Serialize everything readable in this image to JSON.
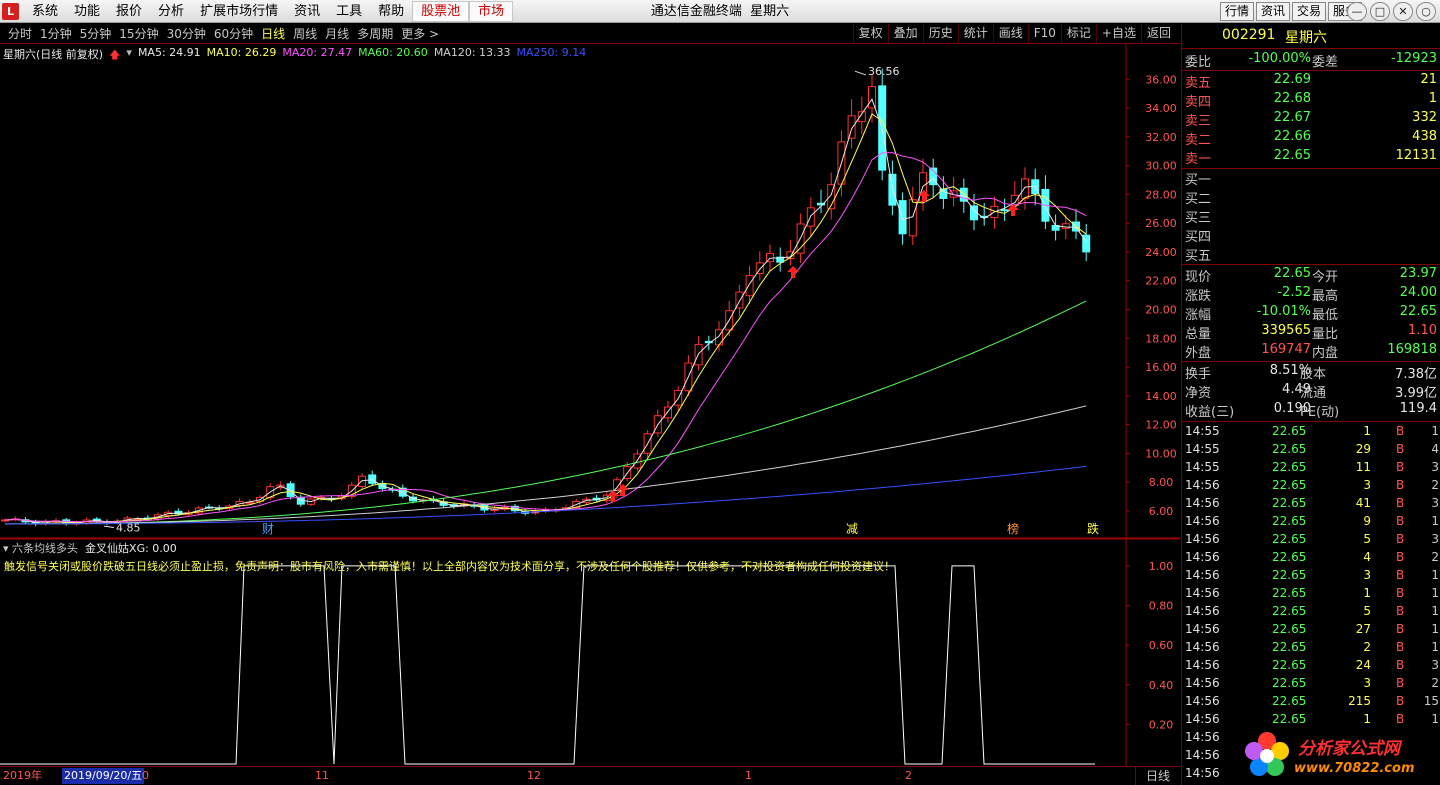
{
  "app": {
    "logo_text": "L",
    "title": "通达信金融终端",
    "stock_title": "星期六"
  },
  "menu": [
    "系统",
    "功能",
    "报价",
    "分析",
    "扩展市场行情",
    "资讯",
    "工具",
    "帮助"
  ],
  "menu_tabs": [
    "股票池",
    "市场"
  ],
  "top_right_buttons": [
    "行情",
    "资讯",
    "交易",
    "服务"
  ],
  "window_controls": [
    "—",
    "□",
    "✕",
    "○"
  ],
  "period_tabs": [
    {
      "label": "分时"
    },
    {
      "label": "1分钟"
    },
    {
      "label": "5分钟"
    },
    {
      "label": "15分钟"
    },
    {
      "label": "30分钟"
    },
    {
      "label": "60分钟"
    },
    {
      "label": "日线",
      "active": true
    },
    {
      "label": "周线"
    },
    {
      "label": "月线"
    },
    {
      "label": "多周期"
    },
    {
      "label": "更多 >"
    }
  ],
  "tool_tabs": [
    "复权",
    "叠加",
    "历史",
    "统计",
    "画线",
    "F10",
    "标记",
    "+自选",
    "返回"
  ],
  "ma_header": {
    "stock_label": "星期六(日线 前复权)",
    "items": [
      {
        "label": "MA5: 24.91",
        "color": "#e8e8e8"
      },
      {
        "label": "MA10: 26.29",
        "color": "#ffff54"
      },
      {
        "label": "MA20: 27.47",
        "color": "#ff54ff"
      },
      {
        "label": "MA60: 20.60",
        "color": "#54ff54"
      },
      {
        "label": "MA120: 13.33",
        "color": "#d0d0d0"
      },
      {
        "label": "MA250: 9.14",
        "color": "#3850ff"
      }
    ]
  },
  "chart_data": [
    {
      "type": "candlestick",
      "title": "",
      "price_axis_ticks": [
        "36.00",
        "34.00",
        "32.00",
        "30.00",
        "28.00",
        "26.00",
        "24.00",
        "22.00",
        "20.00",
        "18.00",
        "16.00",
        "14.00",
        "12.00",
        "10.00",
        "8.00",
        "6.00"
      ],
      "ylim": [
        4.4,
        37.2
      ],
      "max_label": "36.56",
      "min_label": "4.85",
      "event_markers": [
        "财",
        "减",
        "榜",
        "跌"
      ],
      "x_month_labels": [
        "0",
        "11",
        "12",
        "1",
        "2"
      ]
    },
    {
      "type": "line",
      "title": "六条均线多头",
      "subtitle": "金叉仙姑XG: 0.00",
      "y_axis_ticks": [
        "1.00",
        "0.80",
        "0.60",
        "0.40",
        "0.20"
      ],
      "ylim": [
        0,
        1.05
      ]
    }
  ],
  "disclaimer": "触发信号关闭或股价跌破五日线必须止盈止损，免责声明：股市有风险，入市需谨慎！以上全部内容仅为技术面分享，不涉及任何个股推荐！仅供参考，不对投资者构成任何投资建议！",
  "date_bar": {
    "year": "2019年",
    "current": "2019/09/20/五",
    "period": "日线"
  },
  "quote": {
    "code": "002291",
    "name": "星期六",
    "weibi_label": "委比",
    "weibi": "-100.00%",
    "weicha_label": "委差",
    "weicha": "-12923",
    "asks": [
      {
        "label": "卖五",
        "price": "22.69",
        "vol": "21"
      },
      {
        "label": "卖四",
        "price": "22.68",
        "vol": "1"
      },
      {
        "label": "卖三",
        "price": "22.67",
        "vol": "332"
      },
      {
        "label": "卖二",
        "price": "22.66",
        "vol": "438"
      },
      {
        "label": "卖一",
        "price": "22.65",
        "vol": "12131"
      }
    ],
    "bids": [
      {
        "label": "买一"
      },
      {
        "label": "买二"
      },
      {
        "label": "买三"
      },
      {
        "label": "买四"
      },
      {
        "label": "买五"
      }
    ],
    "stats": [
      {
        "l1": "现价",
        "v1": "22.65",
        "c1": "grn",
        "l2": "今开",
        "v2": "23.97",
        "c2": "grn"
      },
      {
        "l1": "涨跌",
        "v1": "-2.52",
        "c1": "grn",
        "l2": "最高",
        "v2": "24.00",
        "c2": "grn"
      },
      {
        "l1": "涨幅",
        "v1": "-10.01%",
        "c1": "grn",
        "l2": "最低",
        "v2": "22.65",
        "c2": "grn"
      },
      {
        "l1": "总量",
        "v1": "339565",
        "c1": "yel",
        "l2": "量比",
        "v2": "1.10",
        "c2": "red"
      },
      {
        "l1": "外盘",
        "v1": "169747",
        "c1": "red",
        "l2": "内盘",
        "v2": "169818",
        "c2": "grn"
      }
    ],
    "fund": [
      {
        "l1": "换手",
        "v1": "8.51%",
        "l2": "股本",
        "v2": "7.38亿"
      },
      {
        "l1": "净资",
        "v1": "4.49",
        "l2": "流通",
        "v2": "3.99亿"
      },
      {
        "l1": "收益(三)",
        "v1": "0.190",
        "l2": "PE(动)",
        "v2": "119.4"
      }
    ],
    "ticks": [
      {
        "t": "14:55",
        "p": "22.65",
        "v": "1",
        "b": "B",
        "n": "1"
      },
      {
        "t": "14:55",
        "p": "22.65",
        "v": "29",
        "b": "B",
        "n": "4"
      },
      {
        "t": "14:55",
        "p": "22.65",
        "v": "11",
        "b": "B",
        "n": "3"
      },
      {
        "t": "14:56",
        "p": "22.65",
        "v": "3",
        "b": "B",
        "n": "2"
      },
      {
        "t": "14:56",
        "p": "22.65",
        "v": "41",
        "b": "B",
        "n": "3"
      },
      {
        "t": "14:56",
        "p": "22.65",
        "v": "9",
        "b": "B",
        "n": "1"
      },
      {
        "t": "14:56",
        "p": "22.65",
        "v": "5",
        "b": "B",
        "n": "3"
      },
      {
        "t": "14:56",
        "p": "22.65",
        "v": "4",
        "b": "B",
        "n": "2"
      },
      {
        "t": "14:56",
        "p": "22.65",
        "v": "3",
        "b": "B",
        "n": "1"
      },
      {
        "t": "14:56",
        "p": "22.65",
        "v": "1",
        "b": "B",
        "n": "1"
      },
      {
        "t": "14:56",
        "p": "22.65",
        "v": "5",
        "b": "B",
        "n": "1"
      },
      {
        "t": "14:56",
        "p": "22.65",
        "v": "27",
        "b": "B",
        "n": "1"
      },
      {
        "t": "14:56",
        "p": "22.65",
        "v": "2",
        "b": "B",
        "n": "1"
      },
      {
        "t": "14:56",
        "p": "22.65",
        "v": "24",
        "b": "B",
        "n": "3"
      },
      {
        "t": "14:56",
        "p": "22.65",
        "v": "3",
        "b": "B",
        "n": "2"
      },
      {
        "t": "14:56",
        "p": "22.65",
        "v": "215",
        "b": "B",
        "n": "15"
      },
      {
        "t": "14:56",
        "p": "22.65",
        "v": "1",
        "b": "B",
        "n": "1"
      },
      {
        "t": "14:56"
      },
      {
        "t": "14:56"
      },
      {
        "t": "14:56"
      }
    ]
  },
  "watermark": {
    "site": "分析家公式网",
    "url": "www.70822.com"
  }
}
